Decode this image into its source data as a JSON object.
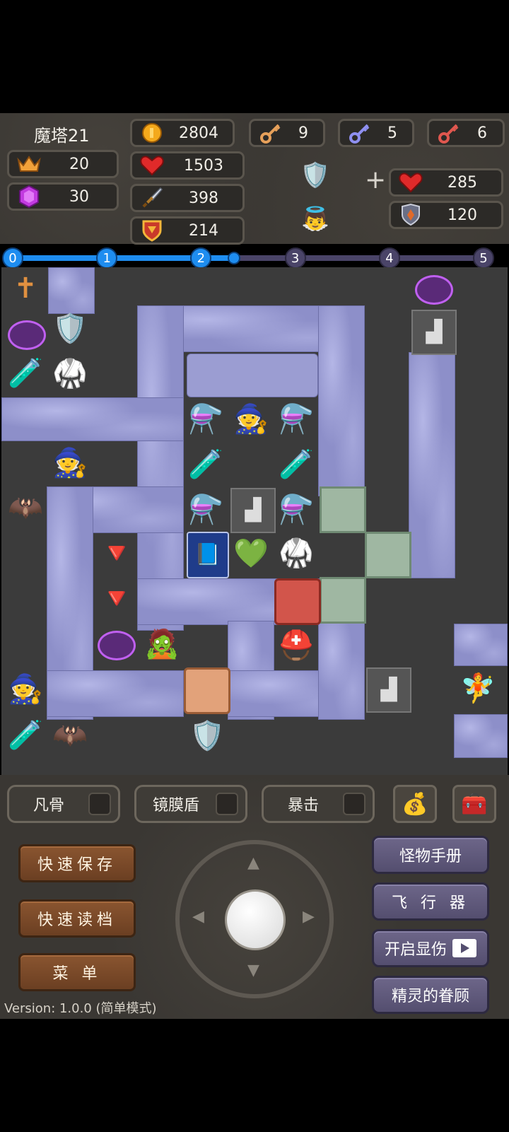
{
  "header": {
    "floor_title": "魔塔21",
    "level": "20",
    "gems": "30",
    "gold": "2804",
    "hp": "1503",
    "attack": "398",
    "defense": "214",
    "yellow_keys": "9",
    "blue_keys": "5",
    "red_keys": "6",
    "bonus_hp": "285",
    "bonus_defense": "120",
    "plus_sign": "+"
  },
  "progress": {
    "nodes": [
      "0",
      "1",
      "2",
      "3",
      "4",
      "5"
    ],
    "value": 0.47
  },
  "skills": {
    "skill1": "凡骨",
    "skill2": "镜膜盾",
    "skill3": "暴击"
  },
  "menu": {
    "quick_save": "快速保存",
    "quick_load": "快速读档",
    "menu": "菜 单",
    "monster_manual": "怪物手册",
    "flyer": "飞 行 器",
    "show_damage": "开启显伤",
    "fairy_favor": "精灵的眷顾"
  },
  "version": "Version: 1.0.0 (简单模式)",
  "colors": {
    "panel": "#3a3733",
    "wall": "#8d8fc9",
    "floor": "#3b3b3b",
    "progress_active": "#1e8df0",
    "progress_inactive": "#4a4468"
  }
}
